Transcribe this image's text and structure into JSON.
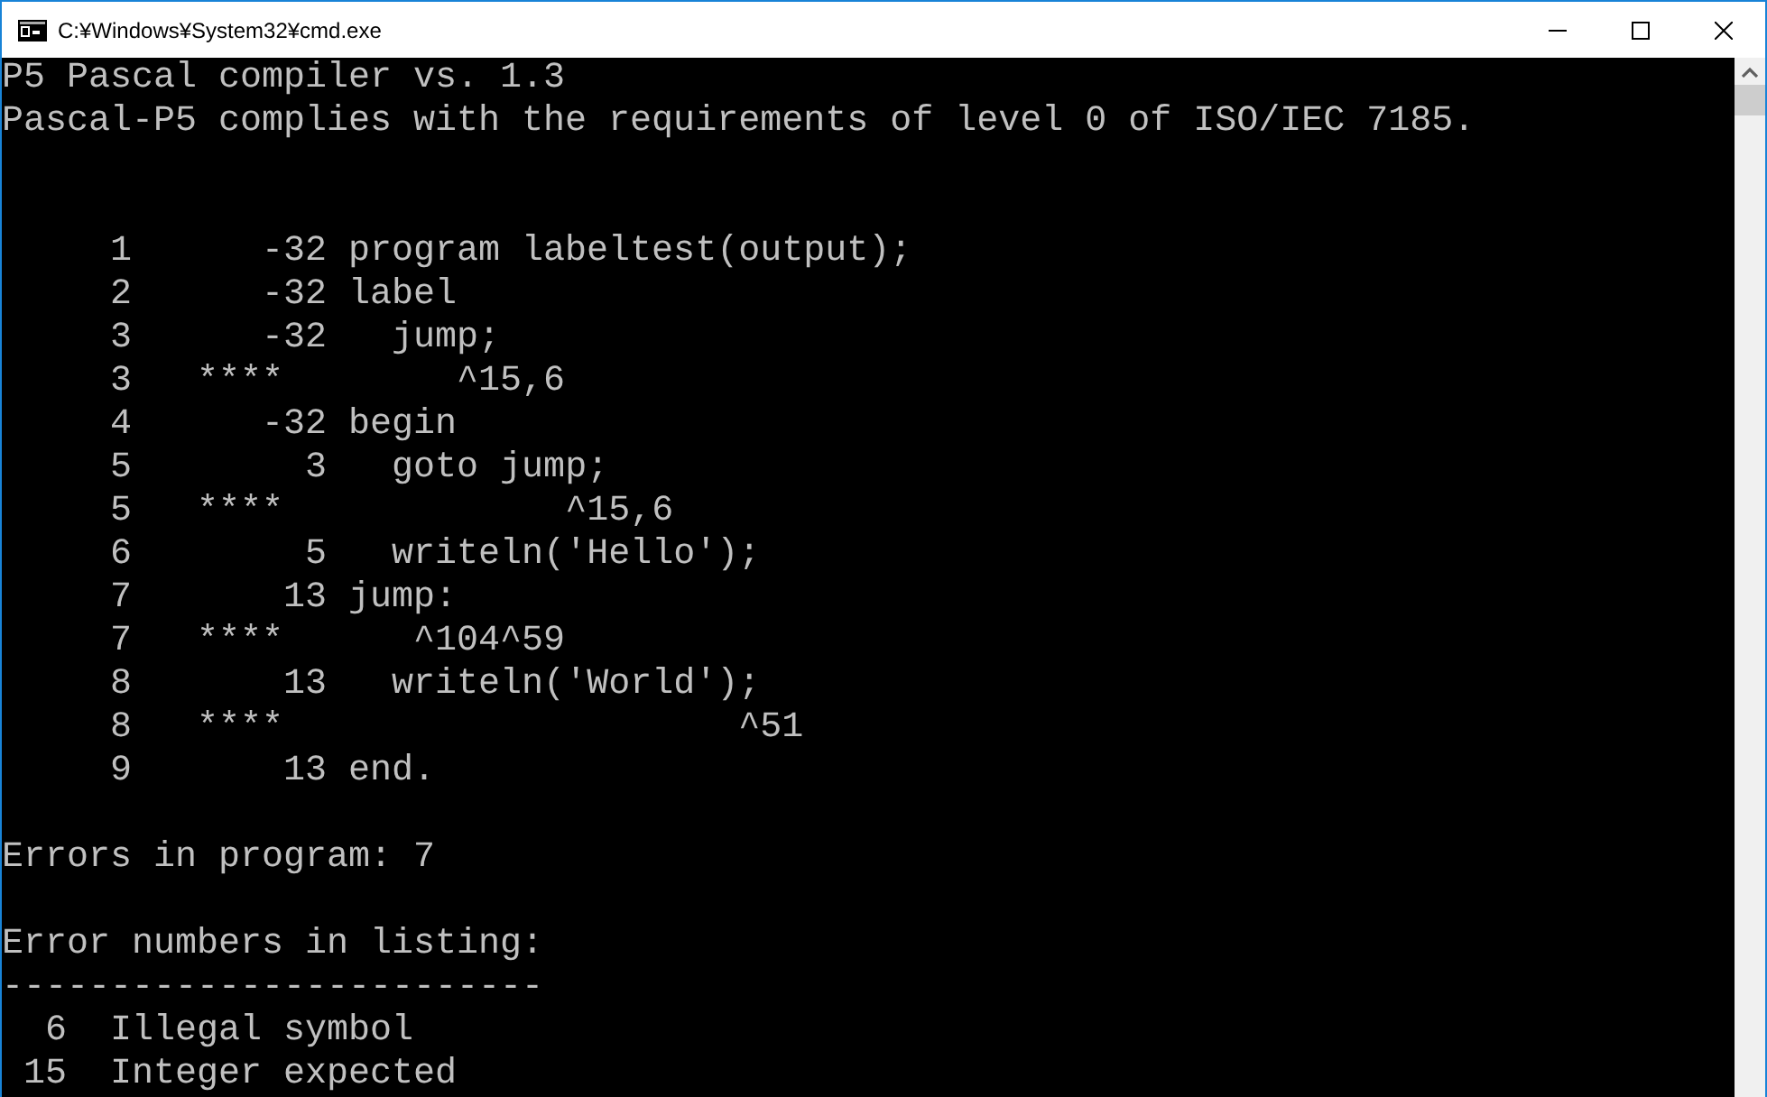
{
  "window": {
    "title": "C:¥Windows¥System32¥cmd.exe"
  },
  "console": {
    "header": [
      "P5 Pascal compiler vs. 1.3",
      "Pascal-P5 complies with the requirements of level 0 of ISO/IEC 7185."
    ],
    "listing": [
      {
        "kind": "source",
        "line": "1",
        "address": "-32",
        "code": "program labeltest(output);"
      },
      {
        "kind": "source",
        "line": "2",
        "address": "-32",
        "code": "label"
      },
      {
        "kind": "source",
        "line": "3",
        "address": "-32",
        "code": "  jump;"
      },
      {
        "kind": "error",
        "line": "3",
        "marker": "****",
        "caret": "        ^15,6"
      },
      {
        "kind": "source",
        "line": "4",
        "address": "-32",
        "code": "begin"
      },
      {
        "kind": "source",
        "line": "5",
        "address": "3",
        "code": "  goto jump;"
      },
      {
        "kind": "error",
        "line": "5",
        "marker": "****",
        "caret": "             ^15,6"
      },
      {
        "kind": "source",
        "line": "6",
        "address": "5",
        "code": "  writeln('Hello');"
      },
      {
        "kind": "source",
        "line": "7",
        "address": "13",
        "code": "jump:"
      },
      {
        "kind": "error",
        "line": "7",
        "marker": "****",
        "caret": "      ^104^59"
      },
      {
        "kind": "source",
        "line": "8",
        "address": "13",
        "code": "  writeln('World');"
      },
      {
        "kind": "error",
        "line": "8",
        "marker": "****",
        "caret": "                     ^51"
      },
      {
        "kind": "source",
        "line": "9",
        "address": "13",
        "code": "end."
      }
    ],
    "summary": "Errors in program: 7",
    "legend_title": "Error numbers in listing:",
    "rule": "-------------------------",
    "errors": [
      {
        "number": "6",
        "message": "Illegal symbol"
      },
      {
        "number": "15",
        "message": "Integer expected"
      }
    ]
  }
}
